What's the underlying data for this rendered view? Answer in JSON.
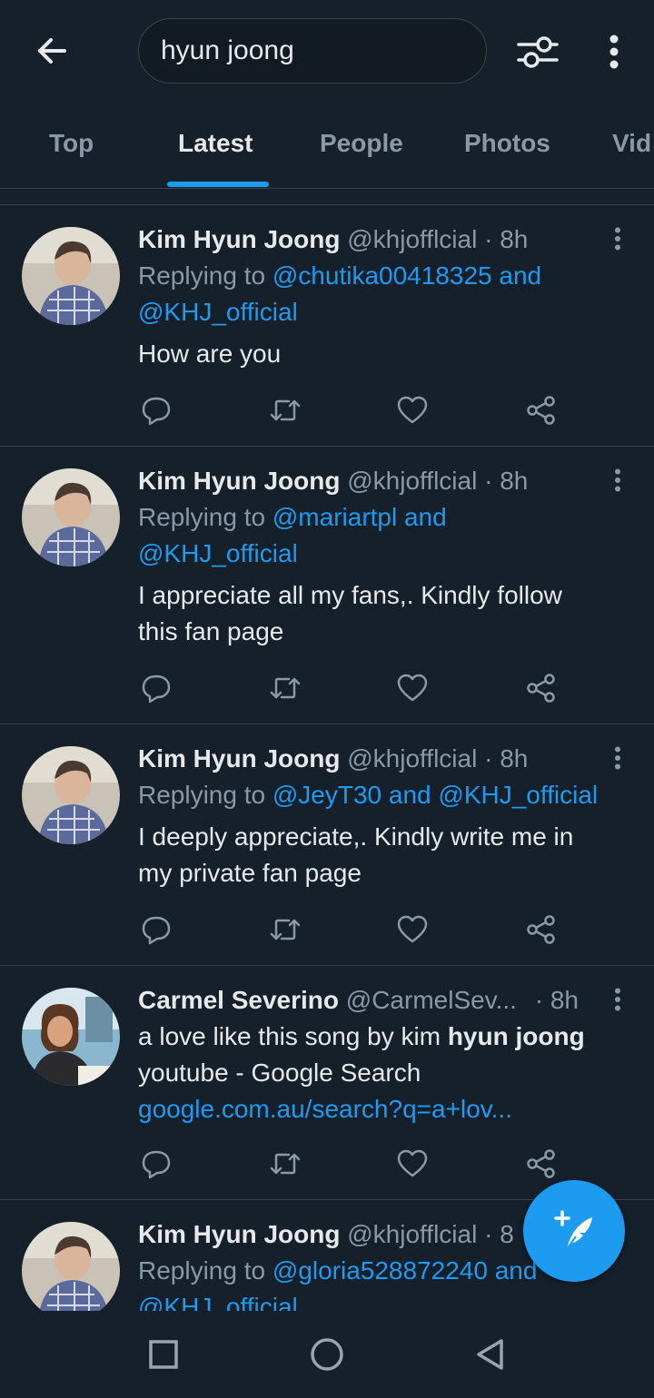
{
  "search": {
    "query": "hyun joong"
  },
  "tabs": [
    {
      "label": "Top"
    },
    {
      "label": "Latest"
    },
    {
      "label": "People"
    },
    {
      "label": "Photos"
    },
    {
      "label": "Vid"
    }
  ],
  "colors": {
    "background": "#15202b",
    "accent": "#1d9bf0",
    "muted": "#8b98a5",
    "divider": "#38444d"
  },
  "tweets": [
    {
      "name": "Kim Hyun Joong",
      "handle": "@khjofflcial",
      "dot": "·",
      "time": "8h",
      "reply_prefix": "Replying to",
      "reply_line1": "@chutika00418325 and",
      "reply_line2": "@KHJ_official",
      "text_line1": "How are you",
      "text_line2": ""
    },
    {
      "name": "Kim Hyun Joong",
      "handle": "@khjofflcial",
      "dot": "·",
      "time": "8h",
      "reply_prefix": "Replying to",
      "reply_line1": "@mariartpl and",
      "reply_line2": "@KHJ_official",
      "text_line1": "I appreciate all my fans,. Kindly follow",
      "text_line2": "this fan page"
    },
    {
      "name": "Kim Hyun Joong",
      "handle": "@khjofflcial",
      "dot": "·",
      "time": "8h",
      "reply_prefix": "Replying to",
      "reply_line1": "@JeyT30 and @KHJ_official",
      "text_line1": "I deeply appreciate,. Kindly write me in",
      "text_line2": "my private fan page"
    },
    {
      "name": "Carmel Severino",
      "handle": "@CarmelSev...",
      "dot": "·",
      "time": "8h",
      "text_pre": "a love like this song by kim ",
      "text_bold": "hyun joong",
      "text_line2": "youtube - Google Search",
      "link": "google.com.au/search?q=a+lov..."
    },
    {
      "name": "Kim Hyun Joong",
      "handle": "@khjofflcial",
      "dot": "·",
      "time": "8",
      "reply_prefix": "Replying to",
      "reply_line1": "@gloria528872240 and",
      "reply_line2": "@KHJ_official"
    }
  ],
  "icons": {
    "back": "arrow-left-icon",
    "filter": "sliders-icon",
    "more": "vertical-dots-icon",
    "reply": "speech-bubble-icon",
    "retweet": "retweet-icon",
    "like": "heart-icon",
    "share": "share-icon",
    "compose": "feather-plus-icon",
    "nav_recents": "square-icon",
    "nav_home": "circle-icon",
    "nav_back": "triangle-icon"
  }
}
